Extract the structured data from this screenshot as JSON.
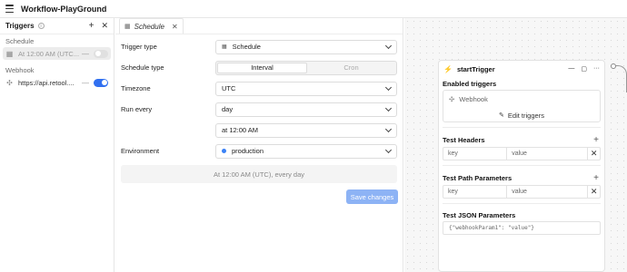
{
  "app": {
    "title": "Workflow-PlayGround"
  },
  "left_panel": {
    "title": "Triggers",
    "info_icon": "info-icon",
    "sections": [
      {
        "label": "Schedule",
        "items": [
          {
            "label": "At 12:00 AM (UTC...",
            "icon": "calendar-icon",
            "enabled": false,
            "selected": true
          }
        ]
      },
      {
        "label": "Webhook",
        "items": [
          {
            "label": "https://api.retool....",
            "icon": "webhook-icon",
            "enabled": true,
            "selected": false
          }
        ]
      }
    ]
  },
  "editor": {
    "tab": {
      "label": "Schedule"
    },
    "fields": {
      "trigger_type": {
        "label": "Trigger type",
        "value": "Schedule"
      },
      "schedule_type": {
        "label": "Schedule type",
        "options": [
          "Interval",
          "Cron"
        ],
        "selected": "Interval"
      },
      "timezone": {
        "label": "Timezone",
        "value": "UTC"
      },
      "run_every": {
        "label": "Run every",
        "value": "day",
        "time": "at 12:00 AM"
      },
      "environment": {
        "label": "Environment",
        "value": "production"
      }
    },
    "summary": "At 12:00 AM (UTC), every day",
    "save_label": "Save changes"
  },
  "node": {
    "title": "startTrigger",
    "enabled_triggers": {
      "title": "Enabled triggers",
      "items": [
        "Webhook"
      ],
      "edit_label": "Edit triggers"
    },
    "test_headers": {
      "title": "Test Headers",
      "key_placeholder": "key",
      "value_placeholder": "value"
    },
    "test_path_params": {
      "title": "Test Path Parameters",
      "key_placeholder": "key",
      "value_placeholder": "value"
    },
    "test_json_params": {
      "title": "Test JSON Parameters",
      "value": "{\"webhookParam1\": \"value\"}"
    }
  },
  "colors": {
    "accent": "#3170f0",
    "save_button": "#8db3f5",
    "production_dot": "#3b82f6"
  }
}
